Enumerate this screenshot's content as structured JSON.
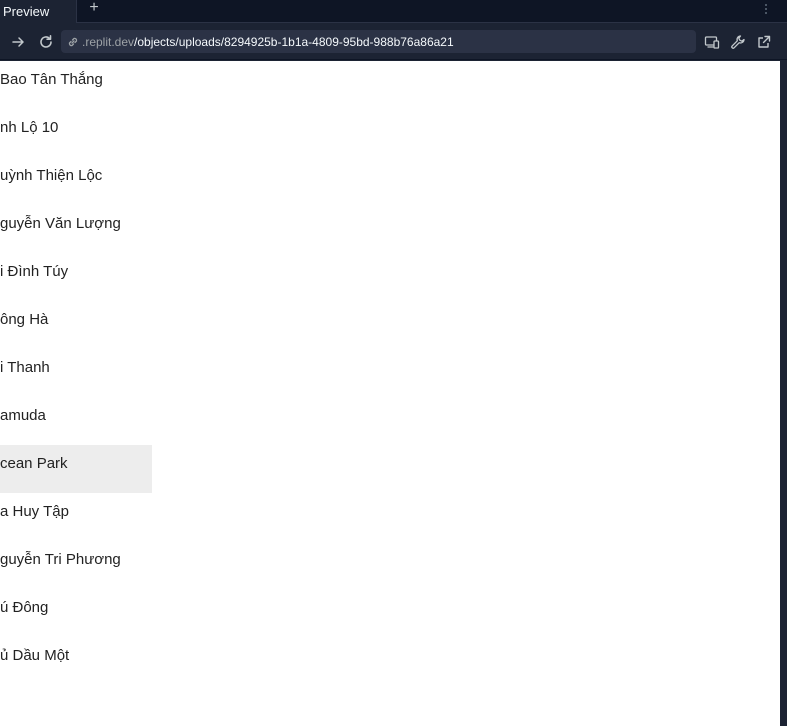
{
  "tabbar": {
    "tab_label": "Preview",
    "add_label": "+"
  },
  "addressbar": {
    "url_host": ".replit.dev",
    "url_path": "/objects/uploads/8294925b-1b1a-4809-95bd-988b76a86a21"
  },
  "list": {
    "items": [
      "Bao Tân Thắng",
      "nh Lộ 10",
      "uỳnh Thiện Lộc",
      "guyễn Văn Lượng",
      "i Đình Túy",
      "ông Hà",
      "i Thanh",
      "amuda",
      "cean Park",
      "a Huy Tập",
      "guyễn Tri Phương",
      "ú Đông",
      "ủ Dầu Một"
    ],
    "highlighted_item": "cean Park"
  },
  "colors": {
    "chrome_background": "#1c2333",
    "url_field_background": "#2b3245",
    "page_background": "#ffffff",
    "highlight_background": "#ededed"
  }
}
